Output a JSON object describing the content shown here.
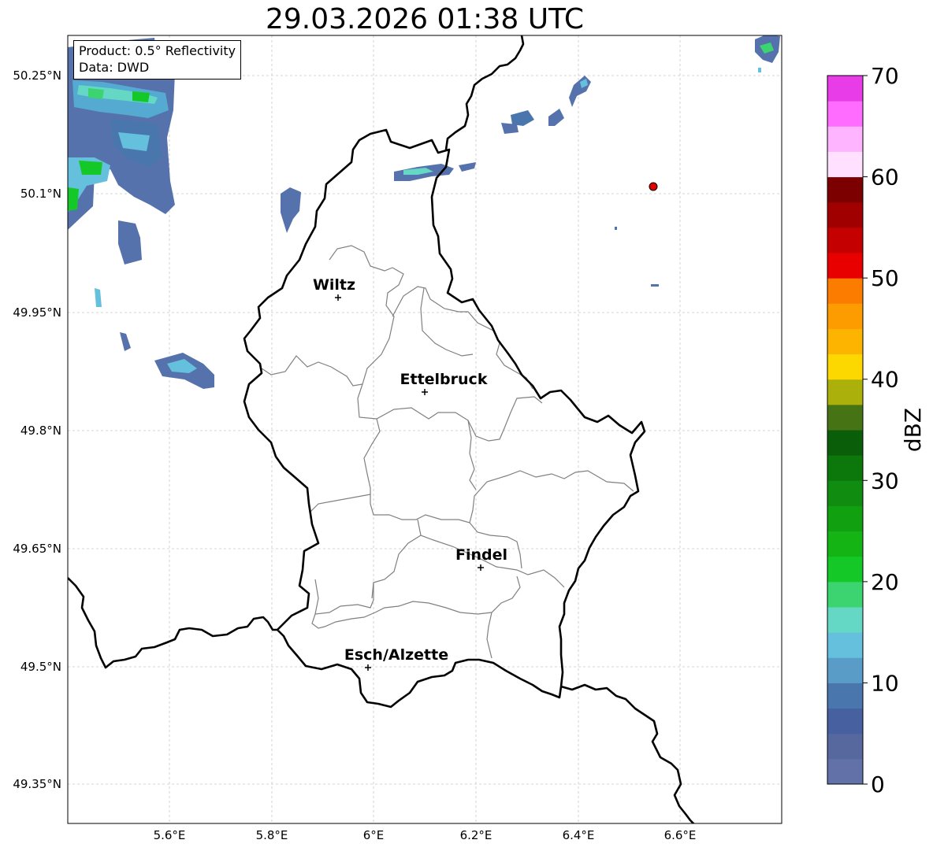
{
  "title": "29.03.2026 01:38 UTC",
  "info_box": {
    "product": "Product: 0.5° Reflectivity",
    "data_source": "Data: DWD"
  },
  "axes": {
    "lon_ticks": [
      "5.6°E",
      "5.8°E",
      "6°E",
      "6.2°E",
      "6.4°E",
      "6.6°E"
    ],
    "lat_ticks": [
      "50.25°N",
      "50.1°N",
      "49.95°N",
      "49.8°N",
      "49.65°N",
      "49.5°N",
      "49.35°N"
    ]
  },
  "cities": [
    {
      "name": "Wiltz"
    },
    {
      "name": "Ettelbruck"
    },
    {
      "name": "Findel"
    },
    {
      "name": "Esch/Alzette"
    }
  ],
  "colorbar": {
    "unit": "dBZ",
    "ticks": [
      "0",
      "10",
      "20",
      "30",
      "40",
      "50",
      "60",
      "70"
    ],
    "colors": [
      "#6272a8",
      "#56689e",
      "#4660a0",
      "#4a76ae",
      "#5a9cc8",
      "#64c0dc",
      "#64d8c4",
      "#3cd470",
      "#14c828",
      "#14b414",
      "#10a010",
      "#108c10",
      "#0c780c",
      "#0a5e0a",
      "#467414",
      "#acb00a",
      "#fcd800",
      "#fcb400",
      "#fc9c00",
      "#fc7c00",
      "#e80000",
      "#c40000",
      "#a00000",
      "#7c0000",
      "#ffe0ff",
      "#ffb4ff",
      "#ff6cff",
      "#e83ce8"
    ]
  },
  "colors": {
    "border_country": "#000000",
    "border_canton": "#808080",
    "radar_site": "#e00000"
  }
}
